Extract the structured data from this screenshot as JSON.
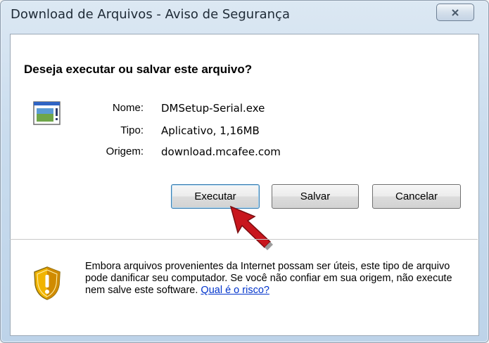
{
  "window": {
    "title": "Download de Arquivos - Aviso de Segurança"
  },
  "dialog": {
    "question": "Deseja executar ou salvar este arquivo?",
    "fields": [
      {
        "label": "Nome:",
        "value": "DMSetup-Serial.exe"
      },
      {
        "label": "Tipo:",
        "value": "Aplicativo, 1,16MB"
      },
      {
        "label": "Origem:",
        "value": "download.mcafee.com"
      }
    ],
    "buttons": {
      "run": "Executar",
      "save": "Salvar",
      "cancel": "Cancelar"
    },
    "warning": {
      "text": "Embora arquivos provenientes da Internet possam ser úteis, este tipo de arquivo pode danificar seu computador. Se você não confiar em sua origem, não execute nem salve este software. ",
      "link": "Qual é o risco?"
    }
  },
  "annotation": {
    "arrow_color": "#c8161d"
  }
}
